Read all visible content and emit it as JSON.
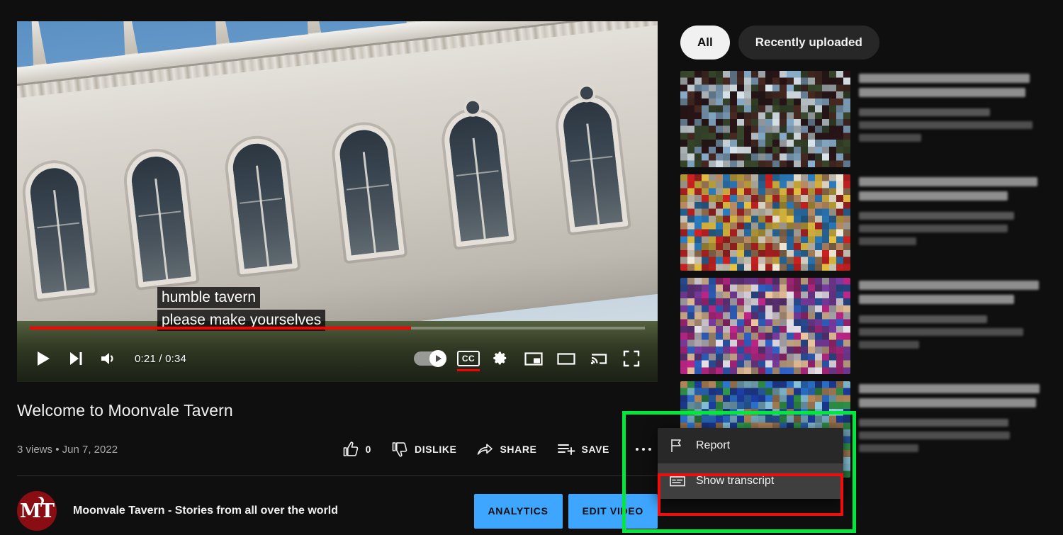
{
  "player": {
    "time_display": "0:21 / 0:34",
    "current_time": "0:21",
    "duration": "0:34",
    "progress_percent": 62,
    "captions": [
      "humble tavern",
      "please make yourselves"
    ],
    "controls": {
      "play": "Play",
      "next": "Next",
      "volume": "Mute",
      "autoplay": "Autoplay is on",
      "subtitles": "Subtitles/closed captions (c)",
      "subtitles_glyph": "CC",
      "subtitles_active": true,
      "settings": "Settings",
      "miniplayer": "Miniplayer (i)",
      "theater": "Theater mode (t)",
      "cast": "Play on TV",
      "fullscreen": "Full screen (f)"
    },
    "accent_color": "#ff0000"
  },
  "video": {
    "title": "Welcome to Moonvale Tavern",
    "views": "3 views",
    "separator": "•",
    "published": "Jun 7, 2022",
    "like_count": "0",
    "actions": [
      {
        "label": "",
        "icon": "thumbs-up-icon",
        "name": "like-button",
        "count": "0"
      },
      {
        "label": "DISLIKE",
        "icon": "thumbs-down-icon",
        "name": "dislike-button"
      },
      {
        "label": "SHARE",
        "icon": "share-icon",
        "name": "share-button"
      },
      {
        "label": "SAVE",
        "icon": "save-to-playlist-icon",
        "name": "save-button"
      }
    ],
    "more_actions": "More actions"
  },
  "channel": {
    "name": "Moonvale Tavern - Stories from all over the world",
    "avatar_monogram": "MT",
    "avatar_color": "#8a0d14",
    "buttons": [
      {
        "label": "ANALYTICS",
        "name": "analytics-button"
      },
      {
        "label": "EDIT VIDEO",
        "name": "edit-video-button"
      }
    ],
    "button_color": "#3ea6ff"
  },
  "more_menu": {
    "items": [
      {
        "label": "Report",
        "icon": "flag-icon",
        "name": "menu-item-report",
        "hovered": false
      },
      {
        "label": "Show transcript",
        "icon": "transcript-icon",
        "name": "menu-item-show-transcript",
        "hovered": true
      }
    ]
  },
  "annotations": {
    "green_box_color": "#00e83c",
    "red_box_color": "#f20d0d",
    "highlighted_target": "Show transcript"
  },
  "sidebar": {
    "chips": [
      {
        "label": "All",
        "active": true,
        "name": "chip-all"
      },
      {
        "label": "Recently uploaded",
        "active": false,
        "name": "chip-recently-uploaded"
      }
    ],
    "recommendations": [
      {
        "name": "recommended-video-1",
        "blurred": true,
        "palette": [
          "#2a1316",
          "#4a2a22",
          "#8ab0cf",
          "#3a4a2c",
          "#d9e4ea"
        ]
      },
      {
        "name": "recommended-video-2",
        "blurred": true,
        "palette": [
          "#f2ead8",
          "#d62121",
          "#e8c341",
          "#b98a62",
          "#2b7fc4"
        ]
      },
      {
        "name": "recommended-video-3",
        "blurred": true,
        "palette": [
          "#c0268a",
          "#e8e2ea",
          "#2f62c8",
          "#f0c8a0",
          "#7a3ba0"
        ]
      },
      {
        "name": "recommended-video-4",
        "blurred": true,
        "palette": [
          "#2b74d4",
          "#2f9c4a",
          "#8fd0e8",
          "#b5875a",
          "#1c3fa8"
        ]
      }
    ]
  }
}
